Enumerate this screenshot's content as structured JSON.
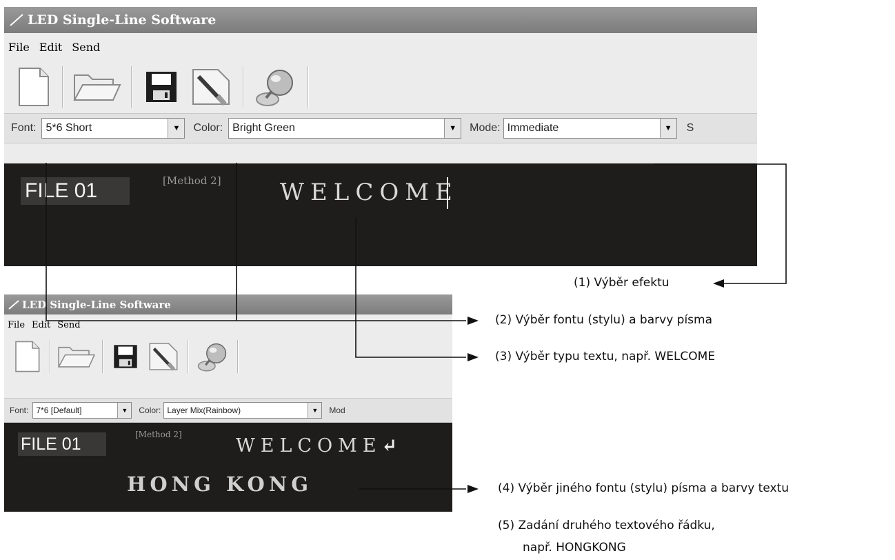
{
  "window1": {
    "title": "LED Single-Line Software",
    "menu": [
      "File",
      "Edit",
      "Send"
    ],
    "toolbar": [
      "new-file-icon",
      "open-folder-icon",
      "save-disk-icon",
      "edit-brush-icon",
      "send-globe-icon"
    ],
    "font_label": "Font:",
    "font_value": "5*6 Short",
    "color_label": "Color:",
    "color_value": "Bright Green",
    "mode_label": "Mode:",
    "mode_value": "Immediate",
    "next_label_fragment": "S",
    "file_tag": "FILE 01",
    "method": "[Method 2]",
    "line1": "WELCOME"
  },
  "window2": {
    "title": "LED Single-Line Software",
    "menu": [
      "File",
      "Edit",
      "Send"
    ],
    "toolbar": [
      "new-file-icon",
      "open-folder-icon",
      "save-disk-icon",
      "edit-brush-icon",
      "send-globe-icon"
    ],
    "font_label": "Font:",
    "font_value": "7*6 [Default]",
    "color_label": "Color:",
    "color_value": "Layer Mix(Rainbow)",
    "mode_label_fragment": "Mod",
    "file_tag": "FILE 01",
    "method": "[Method 2]",
    "line1": "WELCOME",
    "return_symbol": "↵",
    "line2": "HONG KONG"
  },
  "annotations": {
    "a1": "(1) Výběr efektu",
    "a2": "(2) Výběr fontu (stylu) a barvy písma",
    "a3": "(3) Výběr typu textu, např. WELCOME",
    "a4": "(4) Výběr jiného fontu (stylu) písma a barvy textu",
    "a5_line1": "(5) Zadání druhého textového řádku,",
    "a5_line2": "např. HONGKONG"
  }
}
